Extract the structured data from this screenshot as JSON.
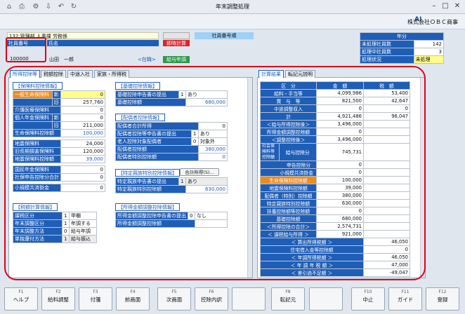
{
  "window": {
    "title": "年末調整処理",
    "icons": [
      "home-icon",
      "print-icon",
      "settings-icon",
      "export-icon",
      "undo-icon",
      "refresh-icon"
    ]
  },
  "ribbon": {
    "logo": "AI",
    "company": "株式会社ＯＢＣ商事"
  },
  "employee": {
    "dept": "132 管理部 人事課 労務係",
    "id_label": "社員番号",
    "id_value": "100000",
    "name_label": "氏名",
    "name_value": "山田　一郎",
    "status_link": "<在職>",
    "right_label": "社員番号順",
    "badge1": "即時計算",
    "badge2": "給与年調"
  },
  "year": {
    "header": "年分",
    "rows": [
      {
        "label": "未処理社員数",
        "value": "142"
      },
      {
        "label": "処理中社員数",
        "value": "3"
      },
      {
        "label": "処理状況",
        "value": "未処理"
      }
    ]
  },
  "tabs_left": [
    "所得控除等",
    "税額控除",
    "中途入社",
    "家族・所得税"
  ],
  "tabs_right": [
    "計算結果",
    "転記元説明"
  ],
  "insurance": {
    "title": "【保険料控除情報】",
    "rows": [
      {
        "label": "一般生命保険料",
        "sub": "新",
        "value": "0"
      },
      {
        "label": "",
        "sub": "旧",
        "value": "257,760"
      },
      {
        "label": "介護医療保険料",
        "sub": "",
        "value": "0"
      },
      {
        "label": "個人年金保険料",
        "sub": "新",
        "value": "0"
      },
      {
        "label": "",
        "sub": "旧",
        "value": "211,000"
      },
      {
        "label": "生命保険料控除額",
        "sub": "",
        "value": "100,000"
      },
      {
        "label": "地震保険料",
        "sub": "",
        "value": "24,000"
      },
      {
        "label": "旧長期損害保険料",
        "sub": "",
        "value": "120,000"
      },
      {
        "label": "地震保険料控除額",
        "sub": "",
        "value": "39,000"
      },
      {
        "label": "国民年金保険料",
        "sub": "",
        "value": "0"
      },
      {
        "label": "社保申告控除分合計",
        "sub": "",
        "value": "0"
      },
      {
        "label": "小規模共済掛金",
        "sub": "",
        "value": "0"
      }
    ]
  },
  "tax_calc": {
    "title": "【税額計算情報】",
    "rows": [
      {
        "label": "課税区分",
        "code": "1",
        "value": "甲欄"
      },
      {
        "label": "年末調整区分",
        "code": "1",
        "value": "年調する"
      },
      {
        "label": "年末調整方法",
        "code": "0",
        "value": "給与年調"
      },
      {
        "label": "単独還付方法",
        "code": "1",
        "value": "給与振込"
      }
    ]
  },
  "basic": {
    "title": "【基礎控除情報】",
    "rows": [
      {
        "label": "基礎控除申告書の提出",
        "code": "1",
        "value": "あり"
      },
      {
        "label": "基礎控除額",
        "code": "",
        "value": "680,000"
      }
    ]
  },
  "spouse": {
    "title": "【配偶者控除情報】",
    "rows": [
      {
        "label": "配偶者合計所得",
        "code": "",
        "value": "0"
      },
      {
        "label": "配偶者控除等申告書の提出",
        "code": "1",
        "value": "あり"
      },
      {
        "label": "老人控除対象配偶者",
        "code": "0",
        "value": "対象外"
      },
      {
        "label": "配偶者控除額",
        "code": "",
        "value": "380,000"
      },
      {
        "label": "配偶者特別控除額",
        "code": "",
        "value": "0"
      }
    ]
  },
  "special": {
    "title": "【特定親族特別控除情報】",
    "button": "合計所得(S)...",
    "rows": [
      {
        "label": "特定親族申告書の提出",
        "code": "1",
        "value": "あり"
      },
      {
        "label": "特定親族特別控除額",
        "code": "",
        "value": "630,000"
      }
    ]
  },
  "income_adj": {
    "title": "【所得金額調整控除情報】",
    "rows": [
      {
        "label": "所得金額調整控除申告書の提出",
        "code": "0",
        "value": "なし"
      },
      {
        "label": "所得金額調整控除額",
        "code": "",
        "value": ""
      }
    ]
  },
  "results": {
    "headers": [
      "区　分",
      "金　額",
      "税　額"
    ],
    "rows": [
      {
        "label": "給料・手当等",
        "amount": "4,099,986",
        "tax": "53,400"
      },
      {
        "label": "賞　与　等",
        "amount": "821,500",
        "tax": "42,647"
      },
      {
        "label": "中途調整収入",
        "amount": "0",
        "tax": "0"
      },
      {
        "label": "計",
        "amount": "4,921,486",
        "tax": "96,047"
      },
      {
        "label": "＜給与所得控除後＞",
        "amount": "3,496,000",
        "tax": ""
      },
      {
        "label": "所得金額調整控除額",
        "amount": "0",
        "tax": ""
      },
      {
        "label": "＜調整控除後＞",
        "amount": "3,496,000",
        "tax": ""
      },
      {
        "label": "給与控除分",
        "amount": "745,731",
        "tax": ""
      },
      {
        "label": "申告控除分",
        "amount": "0",
        "tax": ""
      },
      {
        "label": "小規模共済掛金",
        "amount": "0",
        "tax": ""
      },
      {
        "label": "生命保険料控除額",
        "amount": "100,000",
        "tax": ""
      },
      {
        "label": "地震保険料控除額",
        "amount": "39,000",
        "tax": ""
      },
      {
        "label": "配偶者（特別）控除額",
        "amount": "380,000",
        "tax": ""
      },
      {
        "label": "特定親族特別控除額",
        "amount": "630,000",
        "tax": ""
      },
      {
        "label": "扶養控除額等控除額",
        "amount": "0",
        "tax": ""
      },
      {
        "label": "基礎控除額",
        "amount": "680,000",
        "tax": ""
      },
      {
        "label": "＜所得控除の合計＞",
        "amount": "2,574,731",
        "tax": ""
      },
      {
        "label": "＜ 課税給与所得 ＞",
        "amount": "921,000",
        "tax": ""
      },
      {
        "label": "＜ 算出所得税額 ＞",
        "amount": "",
        "tax": "46,050"
      },
      {
        "label": "住宅借入金等控除額",
        "amount": "",
        "tax": "0"
      },
      {
        "label": "＜ 年調所得税額 ＞",
        "amount": "",
        "tax": "46,050"
      },
      {
        "label": "＜ 年 調 年 税 額 ＞",
        "amount": "",
        "tax": "47,000"
      },
      {
        "label": "＜ 差引過不足額 ＞",
        "amount": "",
        "tax": "-49,047"
      }
    ],
    "group_label": "社会保険料等控除額"
  },
  "fkeys": [
    {
      "k": "F1",
      "l": "ヘルプ"
    },
    {
      "k": "F2",
      "l": "給料調整"
    },
    {
      "k": "F3",
      "l": "付箋"
    },
    {
      "k": "F4",
      "l": "前画面"
    },
    {
      "k": "F5",
      "l": "次画面"
    },
    {
      "k": "F6",
      "l": "控除内訳"
    },
    {
      "k": "",
      "l": ""
    },
    {
      "k": "F8",
      "l": "転記元"
    },
    {
      "k": "",
      "l": ""
    },
    {
      "k": "F10",
      "l": "中止"
    },
    {
      "k": "F11",
      "l": "ガイド"
    },
    {
      "k": "F12",
      "l": "登録"
    }
  ],
  "colors": {
    "accent": "#1f5eb7",
    "highlight": "#e0001a",
    "orange": "#f08a1a",
    "yellow": "#ffff88"
  }
}
